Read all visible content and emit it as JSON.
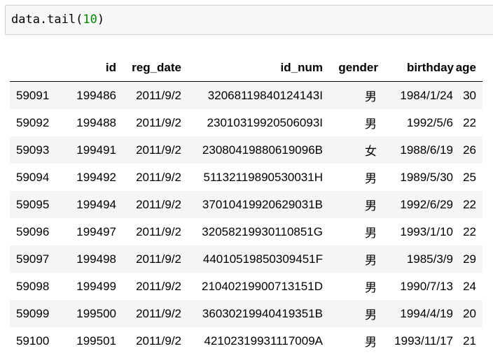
{
  "code_cell": {
    "name": "data.tail",
    "open_paren": "(",
    "argument": "10",
    "close_paren": ")"
  },
  "table": {
    "columns": [
      "",
      "id",
      "reg_date",
      "id_num",
      "gender",
      "birthday",
      "age"
    ],
    "rows": [
      [
        "59091",
        "199486",
        "2011/9/2",
        "32068119840124143I",
        "男",
        "1984/1/24",
        "30"
      ],
      [
        "59092",
        "199488",
        "2011/9/2",
        "23010319920506093I",
        "男",
        "1992/5/6",
        "22"
      ],
      [
        "59093",
        "199491",
        "2011/9/2",
        "23080419880619096B",
        "女",
        "1988/6/19",
        "26"
      ],
      [
        "59094",
        "199492",
        "2011/9/2",
        "51132119890530031H",
        "男",
        "1989/5/30",
        "25"
      ],
      [
        "59095",
        "199494",
        "2011/9/2",
        "37010419920629031B",
        "男",
        "1992/6/29",
        "22"
      ],
      [
        "59096",
        "199497",
        "2011/9/2",
        "32058219930110851G",
        "男",
        "1993/1/10",
        "22"
      ],
      [
        "59097",
        "199498",
        "2011/9/2",
        "44010519850309451F",
        "男",
        "1985/3/9",
        "29"
      ],
      [
        "59098",
        "199499",
        "2011/9/2",
        "21040219900713151D",
        "男",
        "1990/7/13",
        "24"
      ],
      [
        "59099",
        "199500",
        "2011/9/2",
        "36030219940419351B",
        "男",
        "1994/4/19",
        "20"
      ],
      [
        "59100",
        "199501",
        "2011/9/2",
        "42102319931117009A",
        "男",
        "1993/11/17",
        "21"
      ]
    ]
  }
}
